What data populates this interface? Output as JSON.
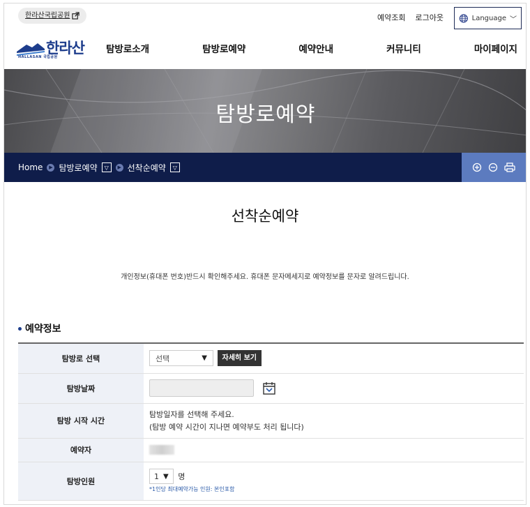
{
  "topbar": {
    "park_link": "한라산국립공원",
    "util": [
      "예약조회",
      "로그아웃"
    ],
    "language": "Language"
  },
  "logo": {
    "wordmark": "한라산",
    "sub": "HALLASAN 국립공원"
  },
  "nav": [
    "탐방로소개",
    "탐방로예약",
    "예약안내",
    "커뮤니티",
    "마이페이지"
  ],
  "hero": {
    "title": "탐방로예약"
  },
  "breadcrumb": {
    "home": "Home",
    "level1": "탐방로예약",
    "level2": "선착순예약"
  },
  "page": {
    "title": "선착순예약",
    "notice": "개인정보(휴대폰 번호)반드시 확인해주세요. 휴대폰 문자메세지로 예약정보를 문자로 알려드립니다."
  },
  "section": {
    "title": "예약정보"
  },
  "form": {
    "rows": [
      {
        "label": "탐방로 선택",
        "select": "선택",
        "button": "자세히 보기"
      },
      {
        "label": "탐방날짜"
      },
      {
        "label": "탐방 시작 시간",
        "line1": "탐방일자를 선택해 주세요.",
        "line2": "(탐방 예약 시간이 지나면 예약부도 처리 됩니다)"
      },
      {
        "label": "예약자"
      },
      {
        "label": "탐방인원",
        "count": "1",
        "unit": "명",
        "hint": "*1인당 최대예약가능 인원: 본인포함"
      }
    ]
  },
  "colors": {
    "navy": "#0f1d4a",
    "tool_blue": "#5c7bbf",
    "brand_blue": "#1d3d8c"
  }
}
